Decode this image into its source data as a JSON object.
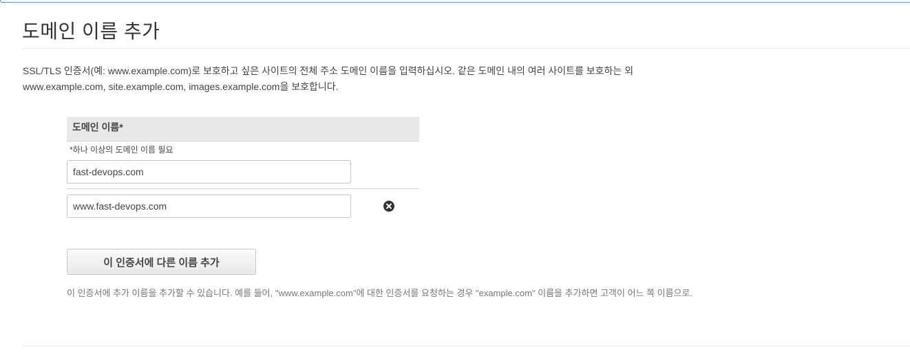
{
  "page_title": "도메인 이름 추가",
  "description": {
    "line1": "SSL/TLS 인증서(예: www.example.com)로 보호하고 싶은 사이트의 전체 주소 도메인 이름을 입력하십시오. 같은 도메인 내의 여러 사이트를 보호하는 외",
    "line2": "www.example.com, site.example.com, images.example.com을 보호합니다."
  },
  "domain_table": {
    "header": "도메인 이름*",
    "required_note": "*하나 이상의 도메인 이름 필요",
    "entries": [
      {
        "value": "fast-devops.com"
      },
      {
        "value": "www.fast-devops.com"
      }
    ]
  },
  "add_button_label": "이 인증서에 다른 이름 추가",
  "help_text": "이 인증서에 추가 이름을 추가할 수 있습니다. 예를 들어, \"www.example.com\"에 대한 인증서를 요청하는 경우 \"example.com\" 이름을 추가하면 고객이 어느 쪽 이름으로.",
  "icons": {
    "remove": "remove-circle-icon"
  }
}
